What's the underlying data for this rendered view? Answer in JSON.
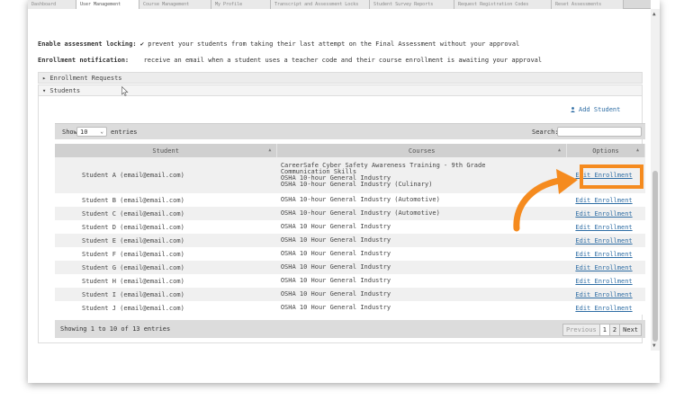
{
  "tabs": [
    "Dashboard",
    "User Management",
    "Course Management",
    "My Profile",
    "Transcript and Assessment Locks",
    "Student Survey Reports",
    "Request Registration Codes",
    "Reset Assessments"
  ],
  "settings": {
    "locking_label": "Enable assessment locking:",
    "locking_text": "prevent your students from taking their last attempt on the Final Assessment without your approval",
    "notify_label": "Enrollment notification:",
    "notify_text": "receive an email when a student uses a teacher code and their course enrollment is awaiting your approval"
  },
  "sections": {
    "enrollment_requests": "▸ Enrollment Requests",
    "students": "▾ Students"
  },
  "add_student": "Add Student",
  "toolbar": {
    "show": "Show",
    "entries_value": "10",
    "entries": "entries",
    "search": "Search:"
  },
  "table": {
    "headers": [
      "Student",
      "Courses",
      "Options"
    ],
    "rows": [
      {
        "student": "Student A (email@email.com)",
        "course": "CareerSafe Cyber Safety Awareness Training - 9th Grade\nCommunication Skills\nOSHA 10-hour General Industry\nOSHA 10-hour General Industry (Culinary)",
        "option": "Edit Enrollment"
      },
      {
        "student": "Student B (email@email.com)",
        "course": "OSHA 10-hour General Industry (Automotive)",
        "option": "Edit Enrollment"
      },
      {
        "student": "Student C (email@email.com)",
        "course": "OSHA 10-hour General Industry (Automotive)",
        "option": "Edit Enrollment"
      },
      {
        "student": "Student D (email@email.com)",
        "course": "OSHA 10 Hour General Industry",
        "option": "Edit Enrollment"
      },
      {
        "student": "Student E (email@email.com)",
        "course": "OSHA 10 Hour General Industry",
        "option": "Edit Enrollment"
      },
      {
        "student": "Student F (email@email.com)",
        "course": "OSHA 10 Hour General Industry",
        "option": "Edit Enrollment"
      },
      {
        "student": "Student G (email@email.com)",
        "course": "OSHA 10 Hour General Industry",
        "option": "Edit Enrollment"
      },
      {
        "student": "Student H (email@email.com)",
        "course": "OSHA 10 Hour General Industry",
        "option": "Edit Enrollment"
      },
      {
        "student": "Student I (email@email.com)",
        "course": "OSHA 10 Hour General Industry",
        "option": "Edit Enrollment"
      },
      {
        "student": "Student J (email@email.com)",
        "course": "OSHA 10 Hour General Industry",
        "option": "Edit Enrollment"
      }
    ]
  },
  "footer": {
    "info": "Showing 1 to 10 of 13 entries",
    "previous": "Previous",
    "page1": "1",
    "page2": "2",
    "next": "Next"
  },
  "colors": {
    "highlight": "#f58b1f",
    "link": "#2e6da4"
  }
}
